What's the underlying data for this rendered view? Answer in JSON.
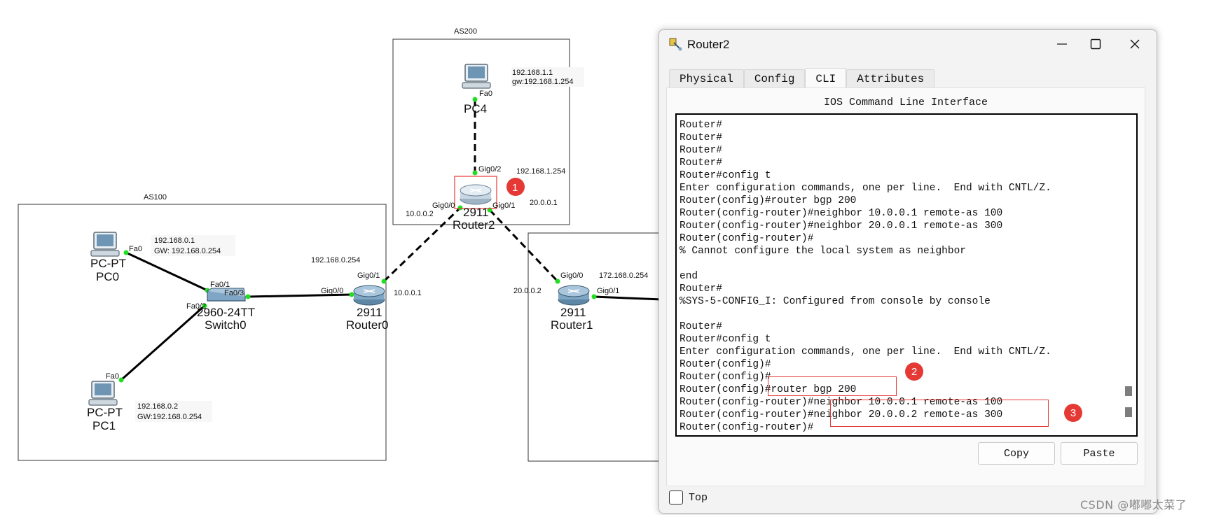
{
  "topology": {
    "as_boxes": {
      "as100": "AS100",
      "as200": "AS200"
    },
    "devices": {
      "pc0": {
        "type": "PC-PT",
        "name": "PC0",
        "ip": "192.168.0.1",
        "gw": "GW:  192.168.0.254",
        "port": "Fa0"
      },
      "pc1": {
        "type": "PC-PT",
        "name": "PC1",
        "ip": "192.168.0.2",
        "gw": "GW:192.168.0.254",
        "port": "Fa0"
      },
      "pc4": {
        "type": "PC-PT",
        "name": "PC4",
        "ip": "192.168.1.1",
        "gw": "gw:192.168.1.254",
        "port": "Fa0"
      },
      "switch0": {
        "type": "2960-24TT",
        "name": "Switch0",
        "ports": [
          "Fa0/1",
          "Fa0/2",
          "Fa0/3"
        ]
      },
      "router0": {
        "type": "2911",
        "name": "Router0",
        "lan_ip": "192.168.0.254",
        "wan_ip": "10.0.0.1",
        "ports": [
          "Gig0/0",
          "Gig0/1"
        ]
      },
      "router1": {
        "type": "2911",
        "name": "Router1",
        "lan_ip": "172.168.0.254",
        "wan_ip": "20.0.0.2",
        "ports": [
          "Gig0/0",
          "Gig0/1"
        ]
      },
      "router2": {
        "type": "2911",
        "name": "Router2",
        "lan_ip": "192.168.1.254",
        "ip_left": "10.0.0.2",
        "ip_right": "20.0.0.1",
        "ports": [
          "Gig0/2",
          "Gig0/0",
          "Gig0/1"
        ]
      }
    },
    "badge1": "1"
  },
  "window": {
    "title": "Router2",
    "tabs": [
      "Physical",
      "Config",
      "CLI",
      "Attributes"
    ],
    "active_tab": "CLI",
    "heading": "IOS Command Line Interface",
    "console_lines": [
      "Router#",
      "Router#",
      "Router#",
      "Router#",
      "Router#config t",
      "Enter configuration commands, one per line.  End with CNTL/Z.",
      "Router(config)#router bgp 200",
      "Router(config-router)#neighbor 10.0.0.1 remote-as 100",
      "Router(config-router)#neighbor 20.0.0.1 remote-as 300",
      "Router(config-router)#",
      "% Cannot configure the local system as neighbor",
      "",
      "end",
      "Router#",
      "%SYS-5-CONFIG_I: Configured from console by console",
      "",
      "Router#",
      "Router#config t",
      "Enter configuration commands, one per line.  End with CNTL/Z.",
      "Router(config)#",
      "Router(config)#",
      "Router(config)#router bgp 200",
      "Router(config-router)#neighbor 10.0.0.1 remote-as 100",
      "Router(config-router)#neighbor 20.0.0.2 remote-as 300",
      "Router(config-router)#"
    ],
    "badge2": "2",
    "badge3": "3",
    "copy_label": "Copy",
    "paste_label": "Paste",
    "top_label": "Top"
  },
  "watermark": "CSDN @嘟嘟太菜了",
  "colors": {
    "link": "#000000",
    "port_dot": "#22dd22",
    "annotation": "#e53935",
    "router_body": "#7fa6c4"
  }
}
